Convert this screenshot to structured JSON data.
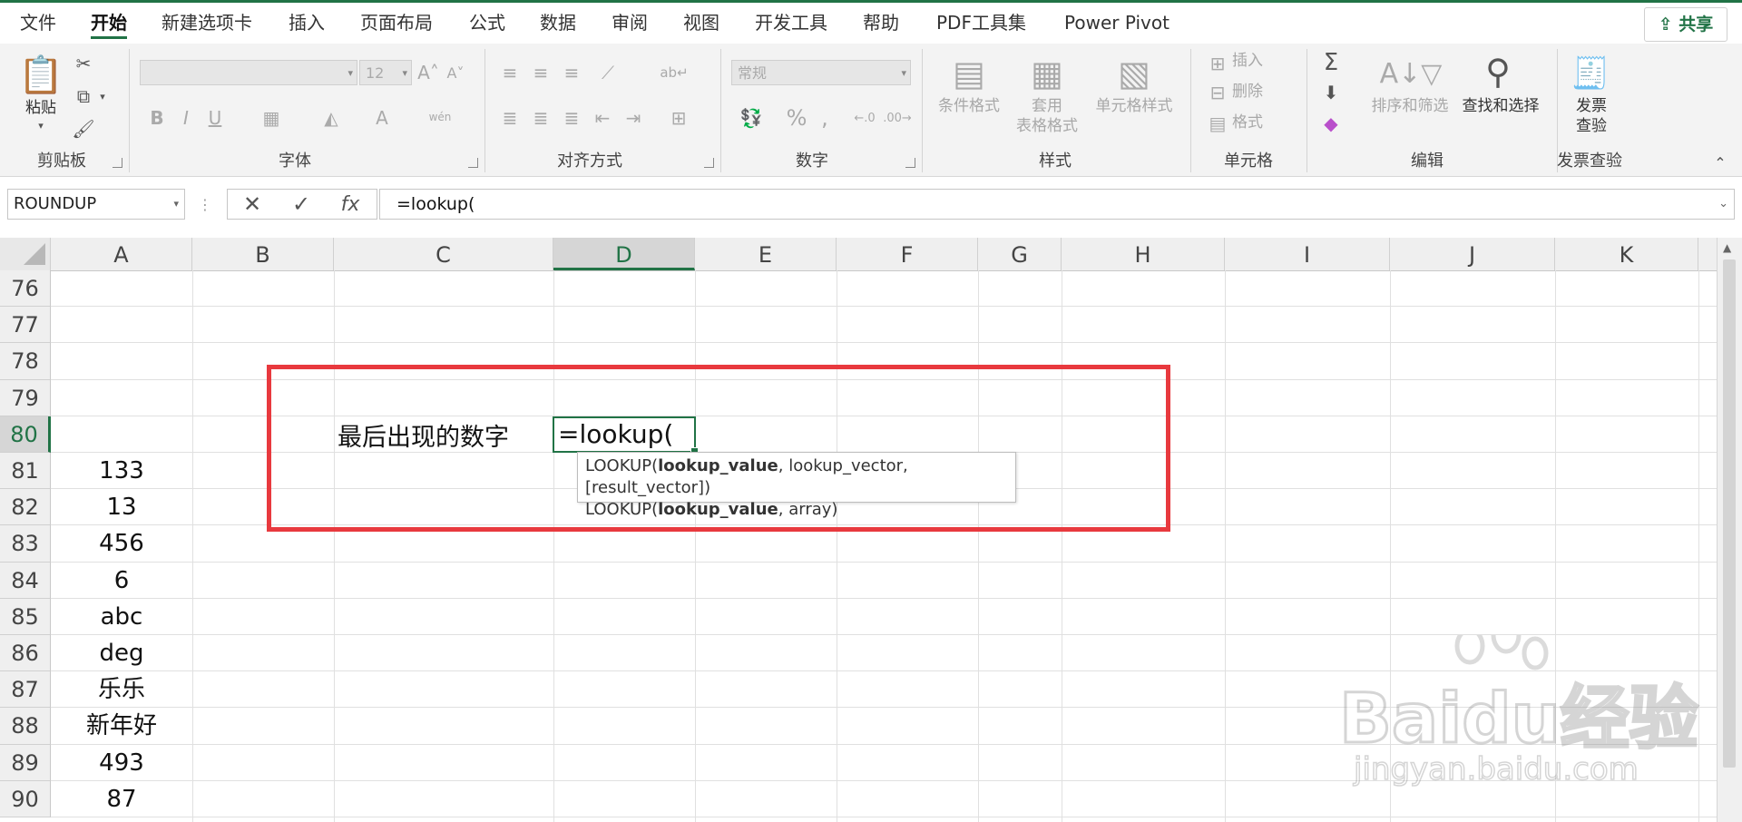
{
  "menu": {
    "tabs": [
      "文件",
      "开始",
      "新建选项卡",
      "插入",
      "页面布局",
      "公式",
      "数据",
      "审阅",
      "视图",
      "开发工具",
      "帮助",
      "PDF工具集",
      "Power Pivot"
    ],
    "active": "开始",
    "share": "共享"
  },
  "ribbon": {
    "clipboard": {
      "paste": "粘贴",
      "group": "剪贴板"
    },
    "font": {
      "size": "12",
      "bold": "B",
      "italic": "I",
      "underline": "U",
      "wen": "wén",
      "group": "字体"
    },
    "alignment": {
      "group": "对齐方式"
    },
    "number": {
      "format": "常规",
      "group": "数字"
    },
    "styles": {
      "conditional": "条件格式",
      "table_1": "套用",
      "table_2": "表格格式",
      "cell_styles": "单元格样式",
      "group": "样式"
    },
    "cells": {
      "insert": "插入",
      "delete": "删除",
      "format": "格式",
      "group": "单元格"
    },
    "editing": {
      "sort_filter": "排序和筛选",
      "find_select": "查找和选择",
      "group": "编辑"
    },
    "invoice": {
      "label_1": "发票",
      "label_2": "查验",
      "group": "发票查验"
    }
  },
  "formula_bar": {
    "name_box": "ROUNDUP",
    "formula": "=lookup(",
    "fx": "fx"
  },
  "columns": [
    "A",
    "B",
    "C",
    "D",
    "E",
    "F",
    "G",
    "H",
    "I",
    "J",
    "K"
  ],
  "selected_column": "D",
  "rows": [
    {
      "num": "76",
      "a": ""
    },
    {
      "num": "77",
      "a": ""
    },
    {
      "num": "78",
      "a": ""
    },
    {
      "num": "79",
      "a": ""
    },
    {
      "num": "80",
      "a": ""
    },
    {
      "num": "81",
      "a": "133"
    },
    {
      "num": "82",
      "a": "13"
    },
    {
      "num": "83",
      "a": "456"
    },
    {
      "num": "84",
      "a": "6"
    },
    {
      "num": "85",
      "a": "abc"
    },
    {
      "num": "86",
      "a": "deg"
    },
    {
      "num": "87",
      "a": "乐乐"
    },
    {
      "num": "88",
      "a": "新年好"
    },
    {
      "num": "89",
      "a": "493"
    },
    {
      "num": "90",
      "a": "87"
    }
  ],
  "selected_row": "80",
  "cells": {
    "c80": "最后出现的数字",
    "d80_edit": "=lookup("
  },
  "tooltip": {
    "line1": {
      "fn": "LOOKUP(",
      "bold": "lookup_value",
      "rest": ", lookup_vector, [result_vector])"
    },
    "line2": {
      "fn": "LOOKUP(",
      "bold": "lookup_value",
      "rest": ", array)"
    }
  },
  "watermark": {
    "brand": "Bai",
    "brand2": "du",
    "cn": "经验",
    "url": "jingyan.baidu.com"
  },
  "colors": {
    "excel_green": "#217346",
    "highlight_red": "#e8393e"
  }
}
